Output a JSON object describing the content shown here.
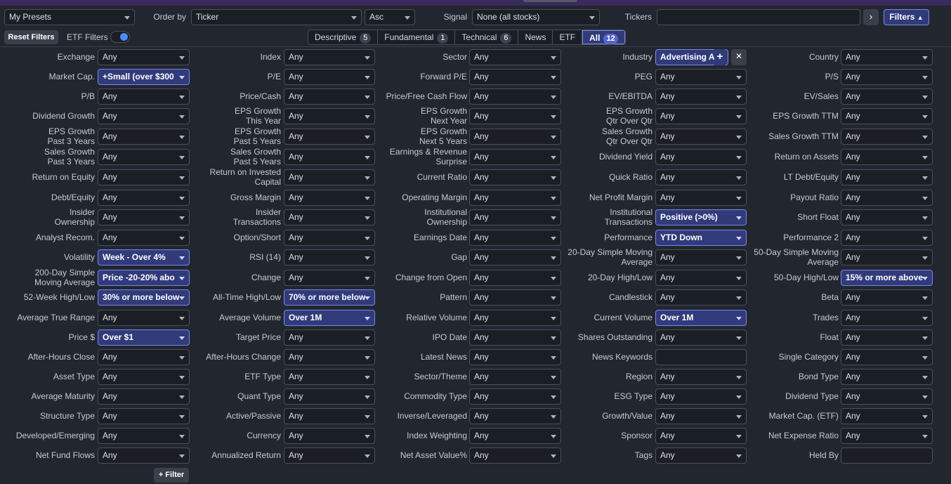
{
  "toolbar": {
    "preset": "My Presets",
    "order_by_label": "Order by",
    "order_by_value": "Ticker",
    "order_dir": "Asc",
    "signal_label": "Signal",
    "signal_value": "None (all stocks)",
    "tickers_label": "Tickers",
    "tickers_value": "",
    "filters_label": "Filters"
  },
  "row2": {
    "reset_filters": "Reset Filters",
    "etf_filters": "ETF Filters",
    "etf_toggle_on": true
  },
  "tabs": [
    {
      "label": "Descriptive",
      "count": "5",
      "active": false
    },
    {
      "label": "Fundamental",
      "count": "1",
      "active": false
    },
    {
      "label": "Technical",
      "count": "6",
      "active": false
    },
    {
      "label": "News",
      "count": "",
      "active": false
    },
    {
      "label": "ETF",
      "count": "",
      "active": false
    },
    {
      "label": "All",
      "count": "12",
      "active": true
    }
  ],
  "colors": {
    "active_fill": "#313b7a",
    "active_border": "#7a88e6",
    "accent": "#4d8cff"
  },
  "filters": [
    [
      [
        "Exchange",
        "Any",
        0
      ],
      [
        "Index",
        "Any",
        0
      ],
      [
        "Sector",
        "Any",
        0
      ],
      [
        "Industry",
        "Advertising Ag",
        1,
        "plusx"
      ],
      [
        "Country",
        "Any",
        0
      ]
    ],
    [
      [
        "Market Cap.",
        "+Small (over $300",
        1
      ],
      [
        "P/E",
        "Any",
        0
      ],
      [
        "Forward P/E",
        "Any",
        0
      ],
      [
        "PEG",
        "Any",
        0
      ],
      [
        "P/S",
        "Any",
        0
      ]
    ],
    [
      [
        "P/B",
        "Any",
        0
      ],
      [
        "Price/Cash",
        "Any",
        0
      ],
      [
        "Price/Free Cash Flow",
        "Any",
        0
      ],
      [
        "EV/EBITDA",
        "Any",
        0
      ],
      [
        "EV/Sales",
        "Any",
        0
      ]
    ],
    [
      [
        "Dividend Growth",
        "Any",
        0
      ],
      [
        "EPS Growth\nThis Year",
        "Any",
        0
      ],
      [
        "EPS Growth\nNext Year",
        "Any",
        0
      ],
      [
        "EPS Growth\nQtr Over Qtr",
        "Any",
        0
      ],
      [
        "EPS Growth TTM",
        "Any",
        0
      ]
    ],
    [
      [
        "EPS Growth\nPast 3 Years",
        "Any",
        0
      ],
      [
        "EPS Growth\nPast 5 Years",
        "Any",
        0
      ],
      [
        "EPS Growth\nNext 5 Years",
        "Any",
        0
      ],
      [
        "Sales Growth\nQtr Over Qtr",
        "Any",
        0
      ],
      [
        "Sales Growth TTM",
        "Any",
        0
      ]
    ],
    [
      [
        "Sales Growth\nPast 3 Years",
        "Any",
        0
      ],
      [
        "Sales Growth\nPast 5 Years",
        "Any",
        0
      ],
      [
        "Earnings & Revenue\nSurprise",
        "Any",
        0
      ],
      [
        "Dividend Yield",
        "Any",
        0
      ],
      [
        "Return on Assets",
        "Any",
        0
      ]
    ],
    [
      [
        "Return on Equity",
        "Any",
        0
      ],
      [
        "Return on Invested\nCapital",
        "Any",
        0
      ],
      [
        "Current Ratio",
        "Any",
        0
      ],
      [
        "Quick Ratio",
        "Any",
        0
      ],
      [
        "LT Debt/Equity",
        "Any",
        0
      ]
    ],
    [
      [
        "Debt/Equity",
        "Any",
        0
      ],
      [
        "Gross Margin",
        "Any",
        0
      ],
      [
        "Operating Margin",
        "Any",
        0
      ],
      [
        "Net Profit Margin",
        "Any",
        0
      ],
      [
        "Payout Ratio",
        "Any",
        0
      ]
    ],
    [
      [
        "Insider\nOwnership",
        "Any",
        0
      ],
      [
        "Insider\nTransactions",
        "Any",
        0
      ],
      [
        "Institutional\nOwnership",
        "Any",
        0
      ],
      [
        "Institutional\nTransactions",
        "Positive (>0%)",
        1
      ],
      [
        "Short Float",
        "Any",
        0
      ]
    ],
    [
      [
        "Analyst Recom.",
        "Any",
        0
      ],
      [
        "Option/Short",
        "Any",
        0
      ],
      [
        "Earnings Date",
        "Any",
        0
      ],
      [
        "Performance",
        "YTD Down",
        1
      ],
      [
        "Performance 2",
        "Any",
        0
      ]
    ],
    [
      [
        "Volatility",
        "Week - Over 4%",
        1
      ],
      [
        "RSI (14)",
        "Any",
        0
      ],
      [
        "Gap",
        "Any",
        0
      ],
      [
        "20-Day Simple Moving\nAverage",
        "Any",
        0
      ],
      [
        "50-Day Simple Moving\nAverage",
        "Any",
        0
      ]
    ],
    [
      [
        "200-Day Simple\nMoving Average",
        "Price -20-20% abo",
        1
      ],
      [
        "Change",
        "Any",
        0
      ],
      [
        "Change from Open",
        "Any",
        0
      ],
      [
        "20-Day High/Low",
        "Any",
        0
      ],
      [
        "50-Day High/Low",
        "15% or more above",
        1
      ]
    ],
    [
      [
        "52-Week High/Low",
        "30% or more below",
        1
      ],
      [
        "All-Time High/Low",
        "70% or more below",
        1
      ],
      [
        "Pattern",
        "Any",
        0
      ],
      [
        "Candlestick",
        "Any",
        0
      ],
      [
        "Beta",
        "Any",
        0
      ]
    ],
    [
      [
        "Average True Range",
        "Any",
        0
      ],
      [
        "Average Volume",
        "Over 1M",
        1
      ],
      [
        "Relative Volume",
        "Any",
        0
      ],
      [
        "Current Volume",
        "Over 1M",
        1
      ],
      [
        "Trades",
        "Any",
        0
      ]
    ],
    [
      [
        "Price $",
        "Over $1",
        1
      ],
      [
        "Target Price",
        "Any",
        0
      ],
      [
        "IPO Date",
        "Any",
        0
      ],
      [
        "Shares Outstanding",
        "Any",
        0
      ],
      [
        "Float",
        "Any",
        0
      ]
    ],
    [
      [
        "After-Hours Close",
        "Any",
        0
      ],
      [
        "After-Hours Change",
        "Any",
        0
      ],
      [
        "Latest News",
        "Any",
        0
      ],
      [
        "News Keywords",
        "",
        0,
        "text"
      ],
      [
        "Single Category",
        "Any",
        0
      ]
    ],
    [
      [
        "Asset Type",
        "Any",
        0
      ],
      [
        "ETF Type",
        "Any",
        0
      ],
      [
        "Sector/Theme",
        "Any",
        0
      ],
      [
        "Region",
        "Any",
        0
      ],
      [
        "Bond Type",
        "Any",
        0
      ]
    ],
    [
      [
        "Average Maturity",
        "Any",
        0
      ],
      [
        "Quant Type",
        "Any",
        0
      ],
      [
        "Commodity Type",
        "Any",
        0
      ],
      [
        "ESG Type",
        "Any",
        0
      ],
      [
        "Dividend Type",
        "Any",
        0
      ]
    ],
    [
      [
        "Structure Type",
        "Any",
        0
      ],
      [
        "Active/Passive",
        "Any",
        0
      ],
      [
        "Inverse/Leveraged",
        "Any",
        0
      ],
      [
        "Growth/Value",
        "Any",
        0
      ],
      [
        "Market Cap. (ETF)",
        "Any",
        0
      ]
    ],
    [
      [
        "Developed/Emerging",
        "Any",
        0
      ],
      [
        "Currency",
        "Any",
        0
      ],
      [
        "Index Weighting",
        "Any",
        0
      ],
      [
        "Sponsor",
        "Any",
        0
      ],
      [
        "Net Expense Ratio",
        "Any",
        0
      ]
    ],
    [
      [
        "Net Fund Flows",
        "Any",
        0
      ],
      [
        "Annualized Return",
        "Any",
        0
      ],
      [
        "Net Asset Value%",
        "Any",
        0
      ],
      [
        "Tags",
        "Any",
        0
      ],
      [
        "Held By",
        "",
        0,
        "text"
      ]
    ]
  ],
  "add_filter": "+ Filter",
  "industry_add_icon": "+",
  "industry_remove_icon": "✕"
}
